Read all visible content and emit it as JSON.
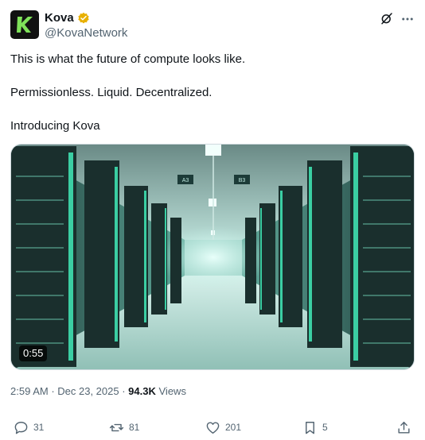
{
  "user": {
    "display_name": "Kova",
    "handle": "@KovaNetwork",
    "verified": true,
    "avatar_letter": "K",
    "avatar_bg": "#111111",
    "avatar_accent": "#7fe25a",
    "verified_color": "#e8b000"
  },
  "header_icons": [
    "grok-icon",
    "more-icon"
  ],
  "post": {
    "line1": "This is what the future of compute looks like.",
    "line2": "Permissionless. Liquid. Decentralized.",
    "line3": "Introducing Kova"
  },
  "media": {
    "type": "video",
    "duration": "0:55",
    "sign_left": "A3",
    "sign_right": "B3",
    "accent": "#38c9a0"
  },
  "meta": {
    "time": "2:59 AM",
    "separator": " · ",
    "date": "Dec 23, 2025",
    "views_count": "94.3K",
    "views_label": "Views"
  },
  "actions": {
    "replies": "31",
    "reposts": "81",
    "likes": "201",
    "bookmarks": "5",
    "icons": [
      "reply-icon",
      "repost-icon",
      "like-icon",
      "bookmark-icon",
      "share-icon"
    ]
  }
}
